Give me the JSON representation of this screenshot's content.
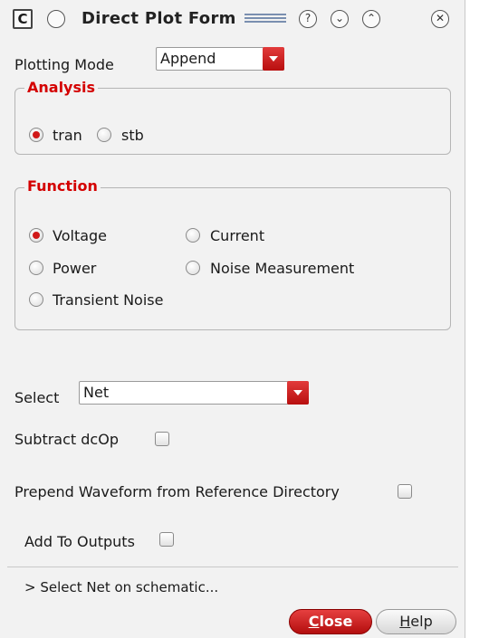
{
  "window": {
    "app_icon": "C",
    "title": "Direct Plot Form"
  },
  "plotting_mode": {
    "label": "Plotting Mode",
    "value": "Append"
  },
  "analysis": {
    "title": "Analysis",
    "options": [
      {
        "label": "tran",
        "selected": true
      },
      {
        "label": "stb",
        "selected": false
      }
    ]
  },
  "function": {
    "title": "Function",
    "options": [
      {
        "label": "Voltage",
        "selected": true
      },
      {
        "label": "Current",
        "selected": false
      },
      {
        "label": "Power",
        "selected": false
      },
      {
        "label": "Noise Measurement",
        "selected": false
      },
      {
        "label": "Transient Noise",
        "selected": false
      }
    ]
  },
  "select": {
    "label": "Select",
    "value": "Net"
  },
  "checkboxes": [
    {
      "label": "Subtract dcOp",
      "checked": false
    },
    {
      "label": "Prepend Waveform from Reference Directory",
      "checked": false
    },
    {
      "label": "Add To Outputs",
      "checked": false
    }
  ],
  "status": "> Select Net on schematic...",
  "buttons": {
    "close": {
      "first": "C",
      "rest": "lose"
    },
    "help": {
      "first": "H",
      "rest": "elp"
    }
  },
  "colors": {
    "accent": "#d01818",
    "group_title": "#d40000"
  }
}
